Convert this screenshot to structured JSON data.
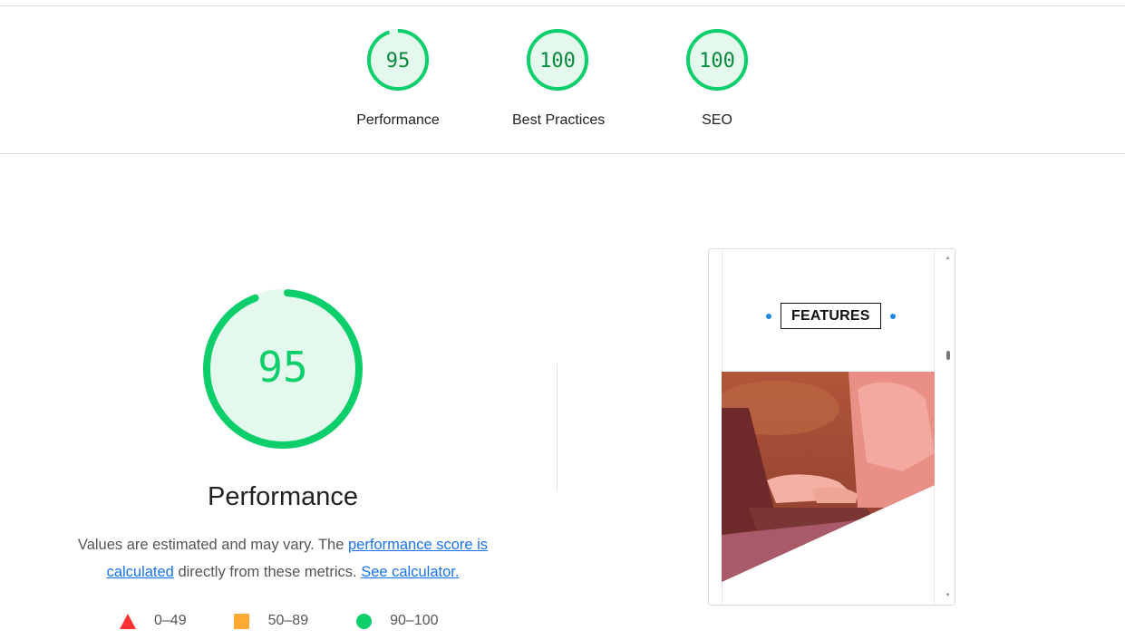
{
  "summary_gauges": [
    {
      "label": "Performance",
      "score": "95",
      "fraction": 0.95
    },
    {
      "label": "Best Practices",
      "score": "100",
      "fraction": 1.0
    },
    {
      "label": "SEO",
      "score": "100",
      "fraction": 1.0
    }
  ],
  "performance": {
    "score": "95",
    "fraction": 0.95,
    "title": "Performance",
    "description_prefix": "Values are estimated and may vary. The ",
    "score_link": "performance score is calculated",
    "description_middle": " directly from these metrics. ",
    "calculator_link": "See calculator."
  },
  "legend": [
    {
      "symbol": "triangle-icon",
      "range": "0–49",
      "color": "#ff3333"
    },
    {
      "symbol": "square-icon",
      "range": "50–89",
      "color": "#ffaa33"
    },
    {
      "symbol": "circle-icon",
      "range": "90–100",
      "color": "#0cce6b"
    }
  ],
  "screenshot": {
    "section_title": "FEATURES"
  },
  "colors": {
    "pass": "#0cce6b",
    "pass_bg": "#e5f8ee",
    "pass_text": "#0b8a3c",
    "link": "#1a73e8"
  }
}
